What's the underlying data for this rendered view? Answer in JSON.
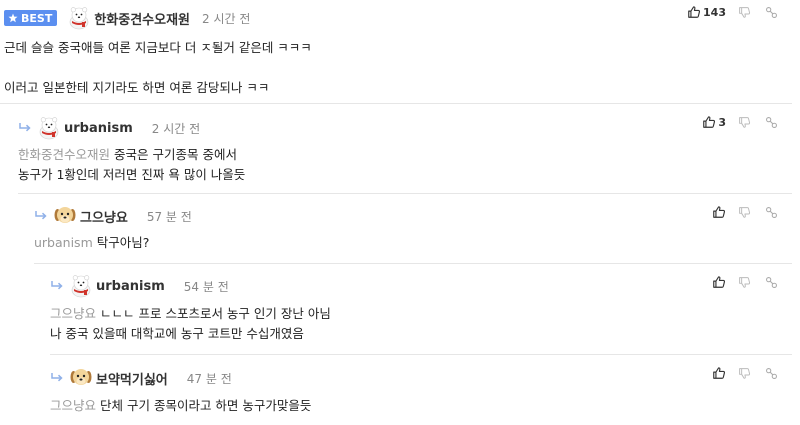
{
  "colors": {
    "accent": "#5b8ff0",
    "muted": "#999999",
    "separator": "#e6e6e6"
  },
  "comments": [
    {
      "badge": "BEST",
      "author": "한화중견수오재원",
      "avatar_icon": "polar-bear-avatar-icon",
      "time": "2 시간 전",
      "likes": "143",
      "lines": [
        "근데 슬슬 중국애들 여론 지금보다 더 ㅈ될거 같은데 ㅋㅋㅋ",
        "",
        "이러고 일본한테 지기라도 하면 여론 감당되나 ㅋㅋ"
      ]
    },
    {
      "author": "urbanism",
      "avatar_icon": "polar-bear-avatar-icon",
      "time": "2 시간 전",
      "likes": "3",
      "mention": "한화중견수오재원",
      "lines": [
        "중국은 구기종목 중에서",
        "농구가 1황인데 저러면 진짜 욕 많이 나올듯"
      ]
    },
    {
      "author": "그으냥요",
      "avatar_icon": "puppy-avatar-icon",
      "time": "57 분 전",
      "likes": "",
      "mention": "urbanism",
      "lines": [
        "탁구아님?"
      ]
    },
    {
      "author": "urbanism",
      "avatar_icon": "polar-bear-avatar-icon",
      "time": "54 분 전",
      "likes": "",
      "mention": "그으냥요",
      "lines": [
        "ㄴㄴㄴ 프로 스포츠로서 농구 인기 장난 아님",
        "나 중국 있을때 대학교에 농구 코트만 수십개였음"
      ]
    },
    {
      "author": "보약먹기싫어",
      "avatar_icon": "puppy-avatar-icon",
      "time": "47 분 전",
      "likes": "",
      "mention": "그으냥요",
      "lines": [
        "단체 구기 종목이라고 하면 농구가맞을듯"
      ]
    }
  ]
}
